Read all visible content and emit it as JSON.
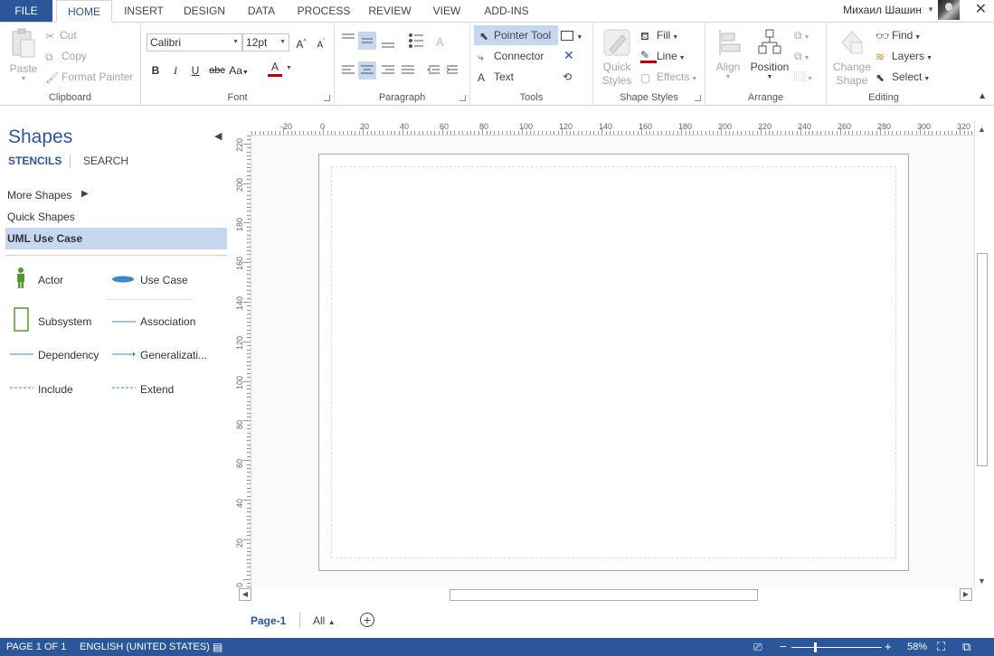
{
  "tabs": {
    "file": "FILE",
    "items": [
      "HOME",
      "INSERT",
      "DESIGN",
      "DATA",
      "PROCESS",
      "REVIEW",
      "VIEW",
      "ADD-INS"
    ]
  },
  "user": {
    "name": "Михаил Шашин"
  },
  "ribbon": {
    "clipboard": {
      "label": "Clipboard",
      "paste": "Paste",
      "cut": "Cut",
      "copy": "Copy",
      "format_painter": "Format Painter"
    },
    "font": {
      "label": "Font",
      "family": "Calibri",
      "size": "12pt"
    },
    "paragraph": {
      "label": "Paragraph"
    },
    "tools": {
      "label": "Tools",
      "pointer": "Pointer Tool",
      "connector": "Connector",
      "text": "Text"
    },
    "shape_styles": {
      "label": "Shape Styles",
      "quick_styles_1": "Quick",
      "quick_styles_2": "Styles",
      "fill": "Fill",
      "line": "Line",
      "effects": "Effects"
    },
    "arrange": {
      "label": "Arrange",
      "align": "Align",
      "position": "Position"
    },
    "editing": {
      "label": "Editing",
      "change_shape_1": "Change",
      "change_shape_2": "Shape",
      "find": "Find",
      "layers": "Layers",
      "select": "Select"
    }
  },
  "shapes_pane": {
    "title": "Shapes",
    "tab_stencils": "STENCILS",
    "tab_search": "SEARCH",
    "more_shapes": "More Shapes",
    "quick_shapes": "Quick Shapes",
    "active_stencil": "UML Use Case",
    "shapes": {
      "actor": "Actor",
      "use_case": "Use Case",
      "subsystem": "Subsystem",
      "association": "Association",
      "dependency": "Dependency",
      "generalization": "Generalizati...",
      "include": "Include",
      "extend": "Extend"
    }
  },
  "ruler": {
    "top_ticks": [
      "-20",
      "0",
      "20",
      "40",
      "60",
      "80",
      "100",
      "120",
      "140",
      "160",
      "180",
      "200",
      "220",
      "240",
      "260",
      "280",
      "300",
      "320"
    ],
    "left_ticks": [
      "220",
      "200",
      "180",
      "160",
      "140",
      "120",
      "100",
      "80",
      "60",
      "40",
      "20",
      "0"
    ]
  },
  "page_tabs": {
    "page": "Page-1",
    "all": "All"
  },
  "status": {
    "page_of": "PAGE 1 OF 1",
    "language": "ENGLISH (UNITED STATES)",
    "zoom": "58%"
  },
  "colors": {
    "accent": "#2b579a",
    "selected": "#c5d8f0",
    "stencil_green": "#4f9a2f",
    "stencil_blue": "#3c87c8"
  }
}
